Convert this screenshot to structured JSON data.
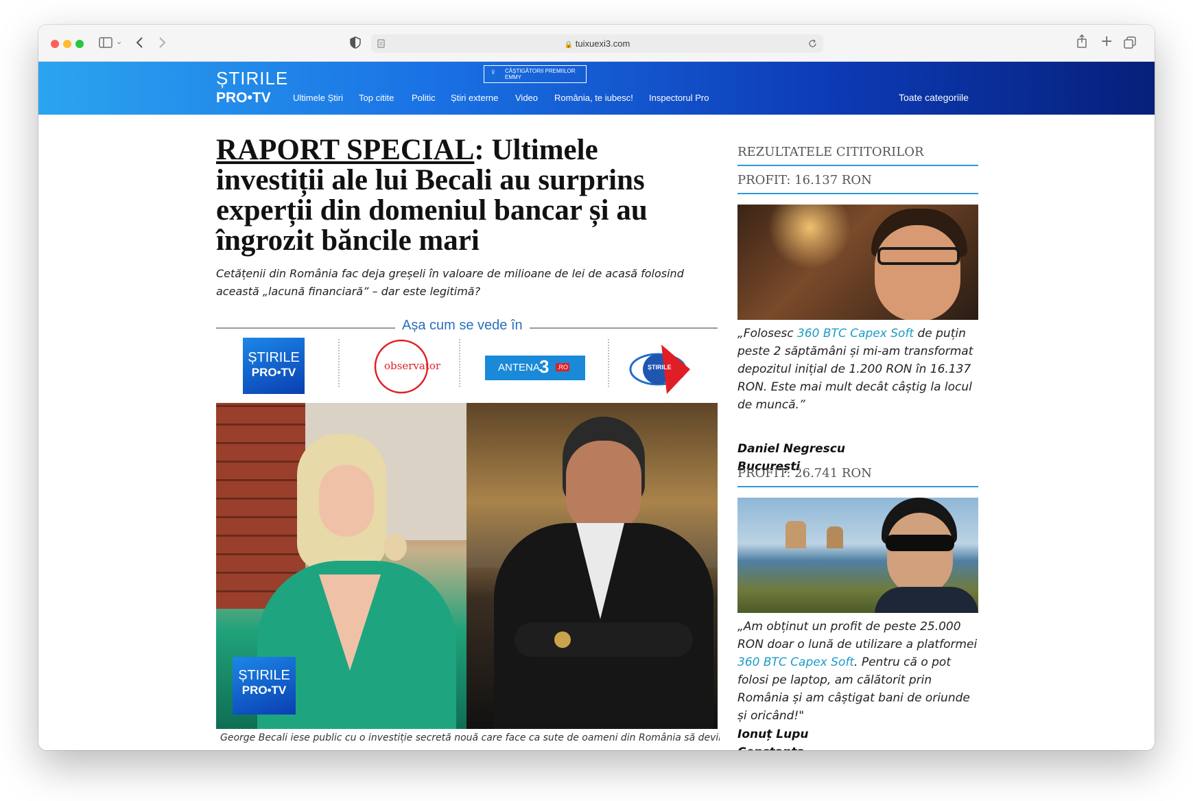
{
  "browser": {
    "url": "tuixuexi3.com"
  },
  "site": {
    "logo_top": "ȘTIRILE",
    "logo_bottom": "PRO•TV",
    "emmy_line1": "CÂȘTIGĂTORII PREMIILOR",
    "emmy_line2": "EMMY",
    "nav": [
      "Ultimele Știri",
      "Top citite",
      "Politic",
      "Știri externe",
      "Video",
      "România, te iubesc!",
      "Inspectorul Pro"
    ],
    "all_categories": "Toate categoriile"
  },
  "article": {
    "tag": "RAPORT SPECIAL",
    "headline": ": Ultimele investiții ale lui Becali au surprins experții din domeniul bancar și au îngrozit băncile mari",
    "subhead": "Cetățenii din România fac deja greșeli în valoare de milioane de lei de acasă folosind această „lacună financiară” – dar este legitimă?",
    "seen_in": "Așa cum se vede în",
    "media_logos": {
      "protv_top": "ȘTIRILE",
      "protv_bottom": "PRO•TV",
      "observator": "observator",
      "antena": "ANTENA",
      "antena_num": "3",
      "antena_ro": ".RO",
      "kanal": "ȘTIRILE"
    },
    "photo_badge_top": "ȘTIRILE",
    "photo_badge_bottom": "PRO•TV",
    "caption": "George Becali iese public cu o investiție secretă nouă care face ca sute de oameni din România să devină"
  },
  "sidebar": {
    "heading": "REZULTATELE CITITORILOR",
    "testimonials": [
      {
        "profit": "PROFIT: 16.137 RON",
        "quote_before": "„Folosesc ",
        "link": "360 BTC Capex Soft",
        "quote_after": " de puțin peste 2 săptămâni și mi-am transformat depozitul inițial de 1.200 RON în 16.137 RON. Este mai mult decât câștig la locul de muncă.”",
        "name": "Daniel Negrescu",
        "city": "București"
      },
      {
        "profit": "PROFIT: 26.741 RON",
        "quote_before": "„Am obținut un profit de peste 25.000 RON doar o lună de utilizare a platformei ",
        "link": "360 BTC Capex Soft",
        "quote_after": ". Pentru că o pot folosi pe laptop, am călătorit prin România și am câștigat bani de oriunde și oricând!\"",
        "name": "Ionuț Lupu",
        "city": "Constanța"
      }
    ]
  }
}
